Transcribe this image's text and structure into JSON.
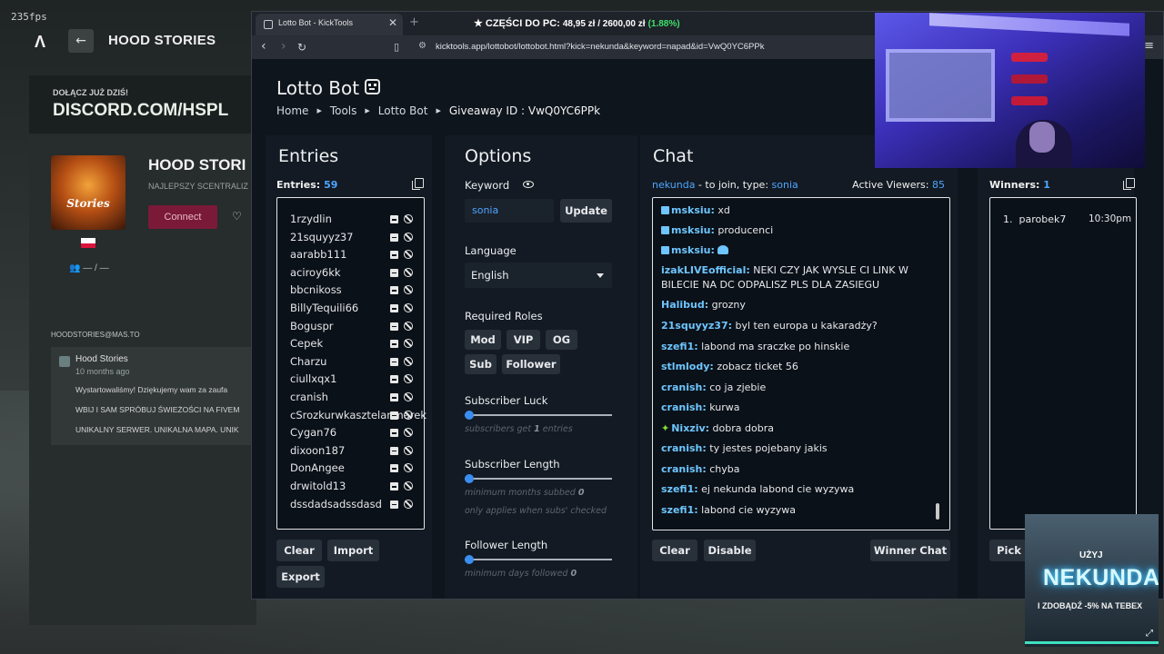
{
  "overlay": {
    "fps": "235fps"
  },
  "stream_bg": {
    "logo": "Λ",
    "back_icon": "←",
    "server_name": "HOOD STORIES",
    "banner_line1": "DOŁĄCZ JUŻ DZIŚ!",
    "banner_line2": "DISCORD.COM/HSPL",
    "title": "HOOD STORI",
    "subtitle": "NAJLEPSZY SCENTRALIZ",
    "connect": "Connect",
    "players": "— / —",
    "email": "HOODSTORIES@MAS.TO",
    "post_author": "Hood Stories",
    "post_time": "10 months ago",
    "post_line1": "Wystartowaliśmy! Dziękujemy wam za zaufa",
    "post_line2": "WBIJ I SAM SPRÓBUJ ŚWIEŻOŚCI NA FIVEM",
    "post_line3": "UNIKALNY SERWER. UNIKALNA MAPA. UNIK",
    "avatar_text": "Stories",
    "flag_colors": [
      "#ffffff",
      "#dc143c"
    ]
  },
  "browser": {
    "tab_title": "Lotto Bot - KickTools",
    "new_tab": "+",
    "close": "✕",
    "ticker_label": "★ CZĘŚCI DO PC:",
    "ticker_value": "48,95 zł / 2600,00 zł",
    "ticker_pct": "(1.88%)",
    "url": "kicktools.app/lottobot/lottobot.html?kick=nekunda&keyword=napad&id=VwQ0YC6PPk"
  },
  "page": {
    "title": "Lotto Bot",
    "breadcrumb": [
      "Home",
      "Tools",
      "Lotto Bot"
    ],
    "giveaway_label": "Giveaway ID :",
    "giveaway_id": "VwQ0YC6PPk"
  },
  "entries": {
    "title": "Entries",
    "count_label": "Entries:",
    "count": "59",
    "items": [
      "1rzydlin",
      "21squyyz37",
      "aarabb111",
      "aciroy6kk",
      "bbcnikoss",
      "BillyTequili66",
      "Boguspr",
      "Cepek",
      "Charzu",
      "ciullxqx1",
      "cranish",
      "cSrozkurwkasztelanmarek",
      "Cygan76",
      "dixoon187",
      "DonAngee",
      "drwitold13",
      "dssdadsadssdasd"
    ],
    "clear": "Clear",
    "import": "Import",
    "export": "Export"
  },
  "options": {
    "title": "Options",
    "keyword_label": "Keyword",
    "keyword_value": "sonia",
    "update": "Update",
    "language_label": "Language",
    "language_value": "English",
    "roles_label": "Required Roles",
    "roles": [
      "Mod",
      "VIP",
      "OG",
      "Sub",
      "Follower"
    ],
    "sub_luck_label": "Subscriber Luck",
    "sub_luck_hint_pre": "subscribers get",
    "sub_luck_value": "1",
    "sub_luck_hint_post": "entries",
    "sub_length_label": "Subscriber Length",
    "sub_length_hint": "minimum months subbed",
    "sub_length_value": "0",
    "sub_length_hint2": "only applies when subs' checked",
    "follower_label": "Follower Length",
    "follower_hint": "minimum days followed",
    "follower_value": "0"
  },
  "chat": {
    "title": "Chat",
    "channel": "nekunda",
    "join_text": " - to join, type: ",
    "keyword": "sonia",
    "viewers_label": "Active Viewers:",
    "viewers": "85",
    "messages": [
      {
        "user": "msksiu:",
        "text": "xd"
      },
      {
        "user": "msksiu:",
        "text": "producenci"
      },
      {
        "user": "msksiu:",
        "text": ""
      },
      {
        "user": "izakLIVEofficial:",
        "text": "NEKI CZY JAK WYSLE CI LINK W BILECIE NA DC ODPALISZ PLS DLA ZASIEGU"
      },
      {
        "user": "Halibud:",
        "text": "grozny"
      },
      {
        "user": "21squyyz37:",
        "text": "byl ten europa u kakaradży?"
      },
      {
        "user": "szefi1:",
        "text": "labond ma sraczke po hinskie"
      },
      {
        "user": "stlmlody:",
        "text": "zobacz ticket 56"
      },
      {
        "user": "cranish:",
        "text": "co ja zjebie"
      },
      {
        "user": "cranish:",
        "text": "kurwa"
      },
      {
        "user": "Nixziv:",
        "text": "dobra dobra"
      },
      {
        "user": "cranish:",
        "text": "ty jestes pojebany jakis"
      },
      {
        "user": "cranish:",
        "text": "chyba"
      },
      {
        "user": "szefi1:",
        "text": "ej nekunda labond cie wyzywa"
      },
      {
        "user": "szefi1:",
        "text": "labond cie wyzywa"
      }
    ],
    "clear": "Clear",
    "disable": "Disable",
    "winner_chat": "Winner Chat"
  },
  "winners": {
    "label": "Winners:",
    "count": "1",
    "items": [
      {
        "rank": "1.",
        "name": "parobek7",
        "time": "10:30pm"
      }
    ],
    "pick": "Pick V"
  },
  "ad": {
    "small": "UŻYJ",
    "big": "NEKUNDA",
    "bottom": "I ZDOBĄDŹ -5% NA TEBEX"
  },
  "colors": {
    "accent": "#4ea6ff",
    "username": "#6ec5ff",
    "page_bg": "#0f151d",
    "panel_bg": "#131a23"
  }
}
